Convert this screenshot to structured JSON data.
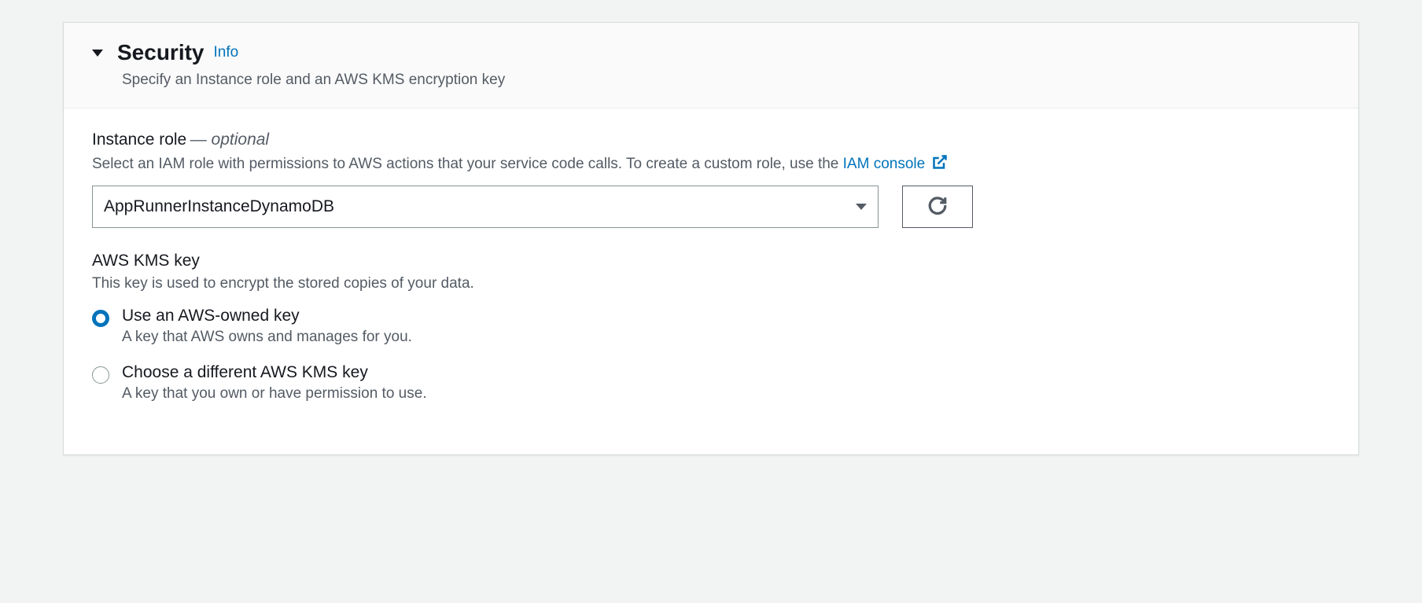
{
  "section": {
    "title": "Security",
    "info_label": "Info",
    "subtitle": "Specify an Instance role and an AWS KMS encryption key"
  },
  "instance_role": {
    "label": "Instance role",
    "optional_marker": "— optional",
    "help_prefix": "Select an IAM role with permissions to AWS actions that your service code calls. To create a custom role, use the ",
    "link_text": "IAM console",
    "selected_value": "AppRunnerInstanceDynamoDB"
  },
  "kms": {
    "label": "AWS KMS key",
    "help": "This key is used to encrypt the stored copies of your data.",
    "options": [
      {
        "label": "Use an AWS-owned key",
        "desc": "A key that AWS owns and manages for you.",
        "selected": true
      },
      {
        "label": "Choose a different AWS KMS key",
        "desc": "A key that you own or have permission to use.",
        "selected": false
      }
    ]
  }
}
